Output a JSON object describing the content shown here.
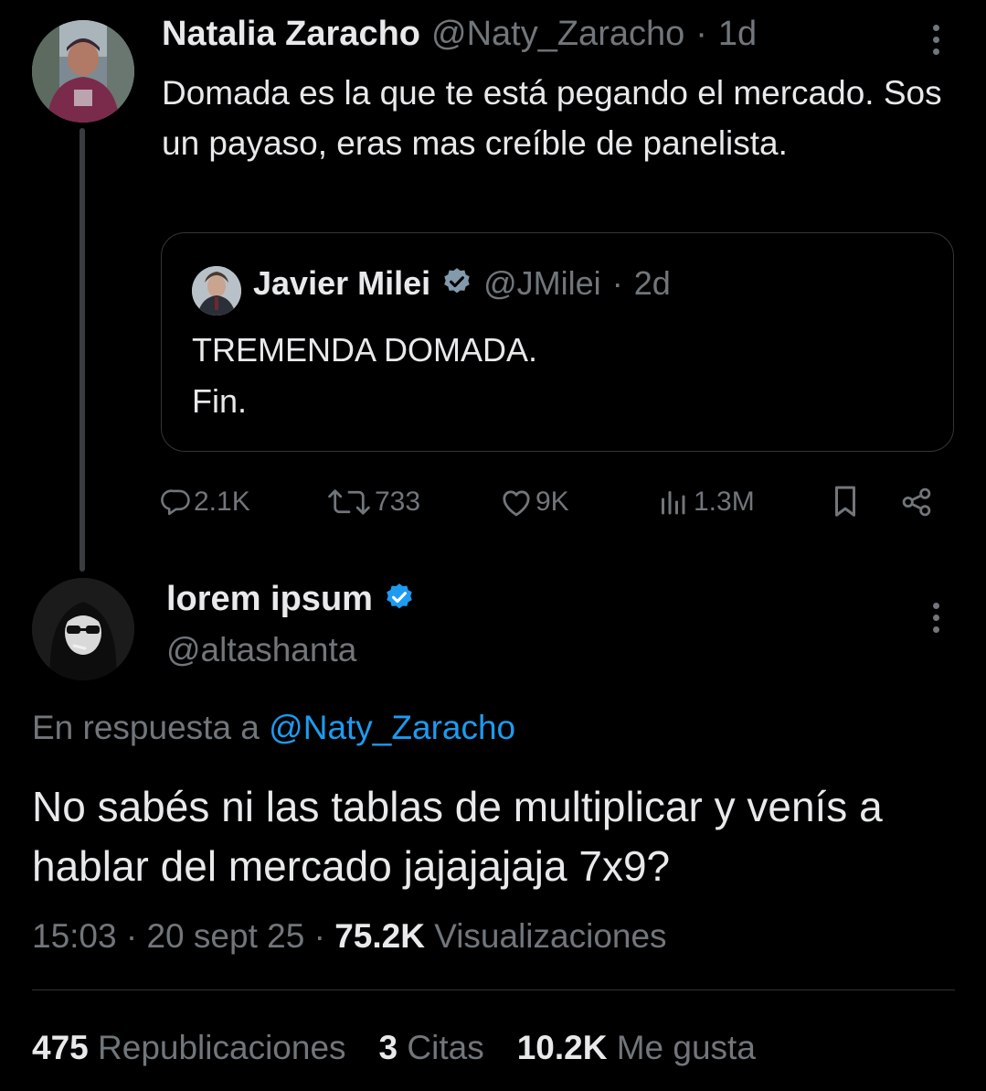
{
  "parent_tweet": {
    "author_name": "Natalia Zaracho",
    "author_handle": "@Naty_Zaracho",
    "time": "1d",
    "text": "Domada es la que te está pegando el mercado. Sos un payaso, eras mas creíble de panelista.",
    "quoted": {
      "author_name": "Javier Milei",
      "author_handle": "@JMilei",
      "time": "2d",
      "text_line1": "TREMENDA DOMADA.",
      "text_line2": "Fin."
    },
    "actions": {
      "replies": "2.1K",
      "reposts": "733",
      "likes": "9K",
      "views": "1.3M"
    }
  },
  "main_tweet": {
    "author_name": "lorem ipsum",
    "author_handle": "@altashanta",
    "reply_prefix": "En respuesta a",
    "reply_to": "@Naty_Zaracho",
    "text": "No sabés ni las tablas de multiplicar y venís a hablar del mercado jajajajaja 7x9?",
    "time": "15:03",
    "date": "20 sept 25",
    "views_count": "75.2K",
    "views_label": "Visualizaciones",
    "stats": {
      "reposts_count": "475",
      "reposts_label": "Republicaciones",
      "quotes_count": "3",
      "quotes_label": "Citas",
      "likes_count": "10.2K",
      "likes_label": "Me gusta"
    }
  },
  "colors": {
    "background": "#000000",
    "text": "#e7e9ea",
    "muted": "#71767b",
    "accent": "#1d9bf0",
    "border": "#333639"
  },
  "icons": [
    "more-icon",
    "verified-badge-icon",
    "reply-icon",
    "repost-icon",
    "like-icon",
    "views-icon",
    "bookmark-icon",
    "share-icon"
  ]
}
